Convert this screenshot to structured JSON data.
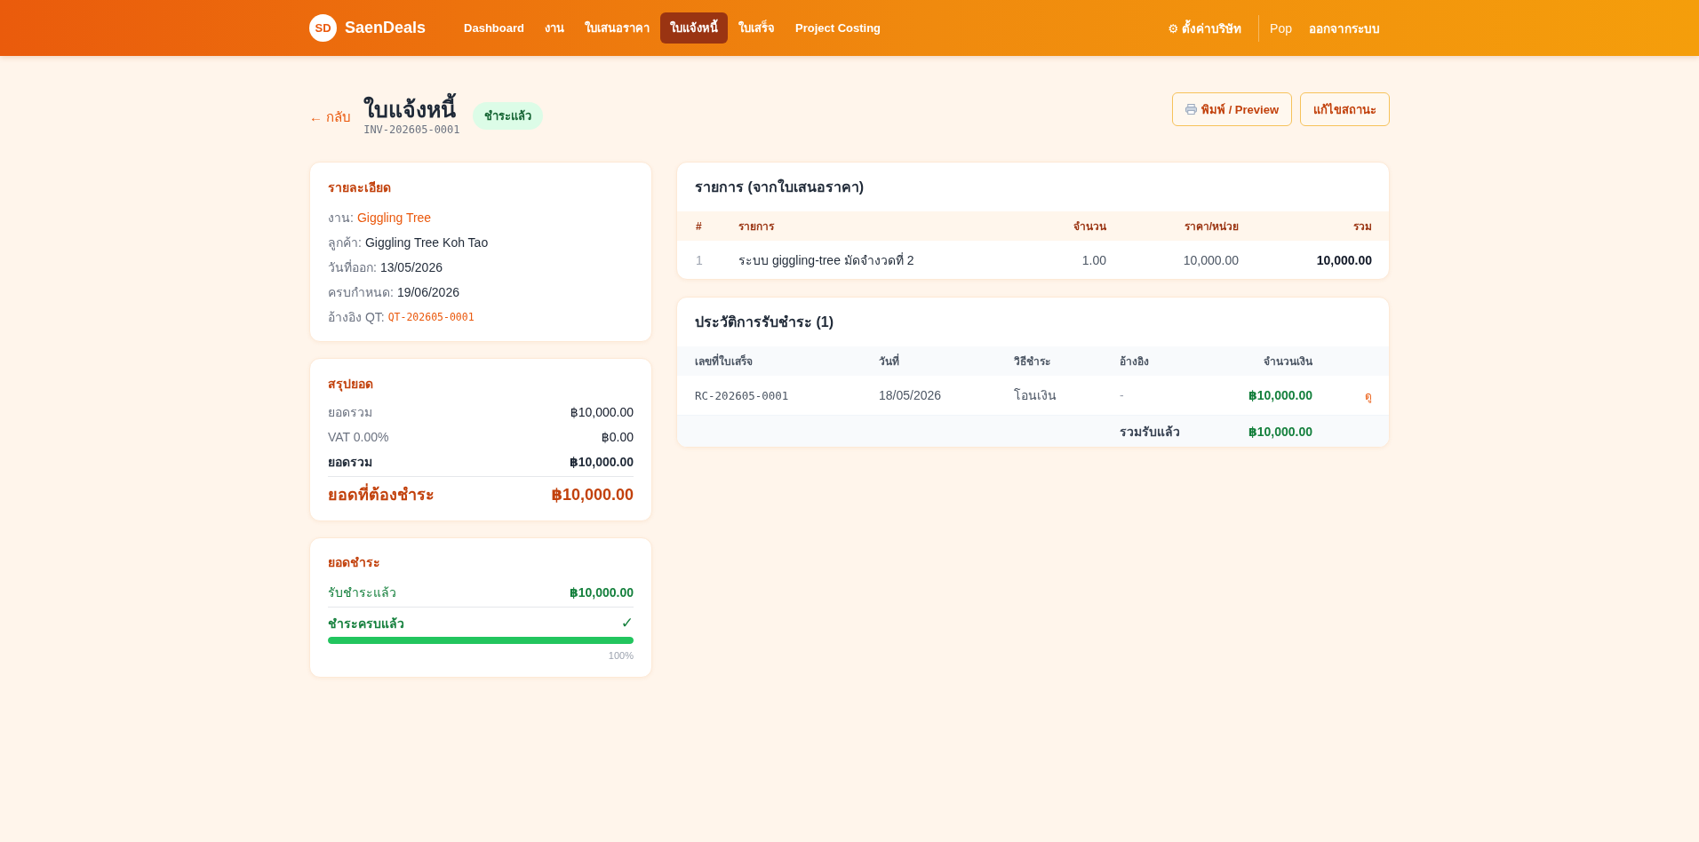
{
  "header": {
    "logo_mark": "SD",
    "brand": "SaenDeals",
    "nav": [
      {
        "label": "Dashboard",
        "selected": false
      },
      {
        "label": "งาน",
        "selected": false
      },
      {
        "label": "ใบเสนอราคา",
        "selected": false
      },
      {
        "label": "ใบแจ้งหนี้",
        "selected": true
      },
      {
        "label": "ใบเสร็จ",
        "selected": false
      },
      {
        "label": "Project Costing",
        "selected": false
      }
    ],
    "settings": "⚙ ตั้งค่าบริษัท",
    "user": "Pop",
    "logout": "ออกจากระบบ"
  },
  "title_bar": {
    "back": "← กลับ",
    "title": "ใบแจ้งหนี้",
    "number": "INV-202605-0001",
    "status": {
      "label": "ชำระแล้ว",
      "kind": "paid"
    },
    "buttons": [
      {
        "label": "พิมพ์ / Preview",
        "kind": "print"
      },
      {
        "label": "แก้ไขสถานะ",
        "kind": "plain"
      }
    ]
  },
  "details": {
    "title": "รายละเอียด",
    "rows": [
      {
        "label": "งาน:",
        "value": "Giggling Tree",
        "kind": "link"
      },
      {
        "label": "ลูกค้า:",
        "value": "Giggling Tree Koh Tao",
        "kind": "text"
      },
      {
        "label": "วันที่ออก:",
        "value": "13/05/2026",
        "kind": "text"
      },
      {
        "label": "ครบกำหนด:",
        "value": "19/06/2026",
        "kind": "text"
      },
      {
        "label": "อ้างอิง QT:",
        "value": "QT-202605-0001",
        "kind": "code"
      }
    ]
  },
  "summary": {
    "title": "สรุปยอด",
    "rows": [
      {
        "label": "ยอดรวม",
        "value": "฿10,000.00",
        "kind": "plain"
      },
      {
        "label": "VAT 0.00%",
        "value": "฿0.00",
        "kind": "plain"
      },
      {
        "label": "ยอดรวม",
        "value": "฿10,000.00",
        "kind": "total"
      },
      {
        "label": "ยอดที่ต้องชำระ",
        "value": "฿10,000.00",
        "kind": "due"
      }
    ]
  },
  "payment": {
    "title": "ยอดชำระ",
    "received_label": "รับชำระแล้ว",
    "received_value": "฿10,000.00",
    "status": "ชำระครบแล้ว",
    "status_mark": "✓",
    "level": 1,
    "reading": "100%"
  },
  "items": {
    "title": "รายการ (จากใบเสนอราคา)",
    "columns": [
      "#",
      "รายการ",
      "จำนวน",
      "ราคา/หน่วย",
      "รวม"
    ],
    "rows": [
      [
        "1",
        "ระบบ giggling-tree มัดจำงวดที่ 2",
        "1.00",
        "10,000.00",
        "10,000.00"
      ]
    ]
  },
  "payments": {
    "title": "ประวัติการรับชำระ (1)",
    "columns": [
      "เลขที่ใบเสร็จ",
      "วันที่",
      "วิธีชำระ",
      "อ้างอิง",
      "จำนวนเงิน"
    ],
    "rows": [
      {
        "receipt": "RC-202605-0001",
        "date": "18/05/2026",
        "method": "โอนเงิน",
        "reference": "-",
        "amount": "฿10,000.00",
        "action": "ดู"
      }
    ],
    "footer": {
      "label": "รวมรับแล้ว",
      "value": "฿10,000.00"
    }
  }
}
